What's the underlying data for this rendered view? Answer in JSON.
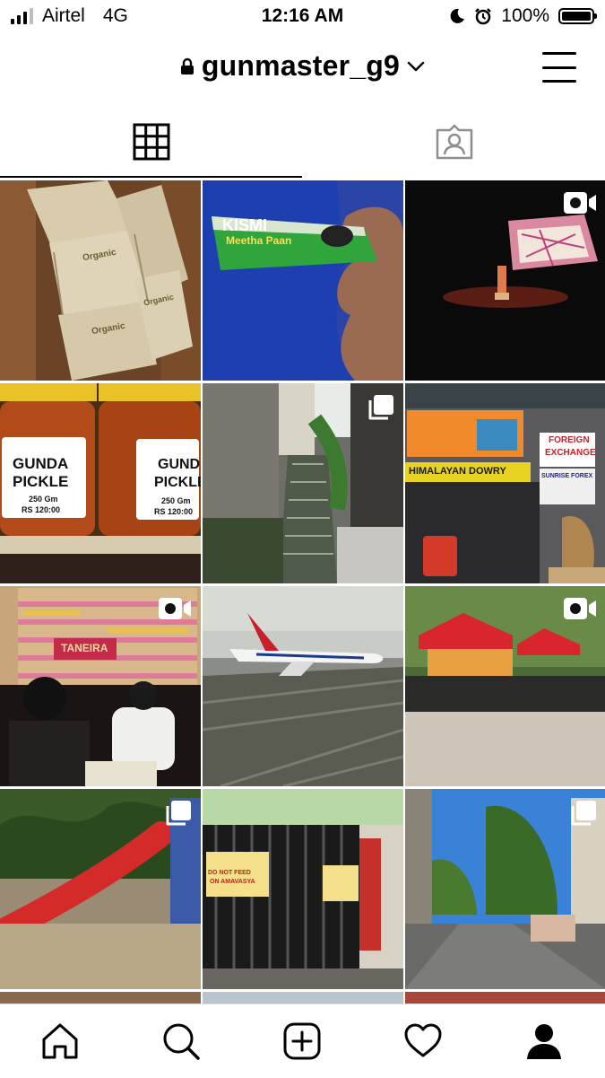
{
  "status_bar": {
    "carrier": "Airtel",
    "network": "4G",
    "time": "12:16 AM",
    "battery": "100%"
  },
  "header": {
    "username": "gunmaster_g9",
    "icons": [
      "lock-icon",
      "chevron-down-icon",
      "menu-icon"
    ]
  },
  "tabs": [
    {
      "name": "grid",
      "icon": "grid-icon",
      "selected": true
    },
    {
      "name": "tagged",
      "icon": "tagged-icon",
      "selected": false
    }
  ],
  "posts": [
    {
      "type": "photo",
      "texts": [
        "Organic",
        "Organic",
        "Organic"
      ]
    },
    {
      "type": "photo",
      "texts": [
        "KISMI",
        "Meetha Paan"
      ]
    },
    {
      "type": "video",
      "texts": []
    },
    {
      "type": "photo",
      "texts": [
        "GUNDA",
        "PICKLE",
        "250 Gm",
        "RS 120:00",
        "GUNDA",
        "PICKLE",
        "250 Gm",
        "RS 120:00"
      ]
    },
    {
      "type": "carousel",
      "texts": []
    },
    {
      "type": "photo",
      "texts": [
        "HIMALAYAN DOWRY",
        "FOREIGN",
        "EXCHANGE",
        "SUNRISE FOREX"
      ]
    },
    {
      "type": "video",
      "texts": [
        "TANEIRA"
      ]
    },
    {
      "type": "photo",
      "texts": []
    },
    {
      "type": "video",
      "texts": []
    },
    {
      "type": "carousel",
      "texts": []
    },
    {
      "type": "photo",
      "texts": [
        "DO NOT FEED",
        "ON AMAVASYA"
      ]
    },
    {
      "type": "carousel",
      "texts": []
    }
  ],
  "tabbar": {
    "items": [
      "home-icon",
      "search-icon",
      "add-icon",
      "heart-icon",
      "profile-icon"
    ]
  }
}
